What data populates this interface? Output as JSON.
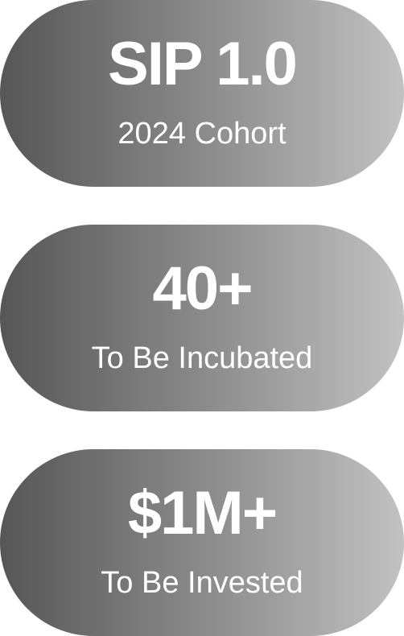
{
  "stats": [
    {
      "value": "SIP 1.0",
      "label": "2024 Cohort"
    },
    {
      "value": "40+",
      "label": "To Be Incubated"
    },
    {
      "value": "$1M+",
      "label": "To Be Invested"
    }
  ],
  "colors": {
    "gradient_start": "#565656",
    "gradient_end": "#c2c2c2",
    "text": "#ffffff",
    "background": "#ffffff"
  }
}
